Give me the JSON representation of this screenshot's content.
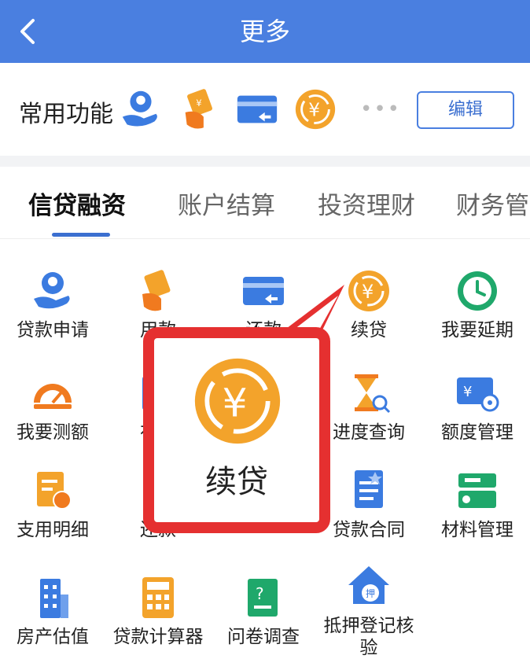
{
  "header": {
    "title": "更多"
  },
  "common": {
    "label": "常用功能",
    "icons": [
      "loan-apply-icon",
      "repay-icon",
      "card-icon",
      "yuan-coin-icon"
    ],
    "more": "•••",
    "edit_label": "编辑"
  },
  "tabs": [
    {
      "label": "信贷融资",
      "active": true
    },
    {
      "label": "账户结算"
    },
    {
      "label": "投资理财"
    },
    {
      "label": "财务管理"
    }
  ],
  "grid": [
    {
      "label": "贷款申请",
      "icon": "loan-apply-icon"
    },
    {
      "label": "用款",
      "icon": "repay-icon"
    },
    {
      "label": "还款",
      "icon": "card-icon"
    },
    {
      "label": "续贷",
      "icon": "yuan-coin-icon"
    },
    {
      "label": "我要延期",
      "icon": "clock-icon"
    },
    {
      "label": "我要测额",
      "icon": "gauge-icon"
    },
    {
      "label": "在线",
      "icon": "loan-icon"
    },
    {
      "label": "",
      "icon": ""
    },
    {
      "label": "进度查询",
      "icon": "hourglass-search-icon"
    },
    {
      "label": "额度管理",
      "icon": "quota-card-icon"
    },
    {
      "label": "支用明细",
      "icon": "detail-doc-icon"
    },
    {
      "label": "还款",
      "icon": "repay-doc-icon"
    },
    {
      "label": "",
      "icon": ""
    },
    {
      "label": "贷款合同",
      "icon": "contract-icon"
    },
    {
      "label": "材料管理",
      "icon": "folder-icon"
    },
    {
      "label": "房产估值",
      "icon": "building-icon"
    },
    {
      "label": "贷款计算器",
      "icon": "calculator-icon"
    },
    {
      "label": "问卷调查",
      "icon": "survey-icon"
    },
    {
      "label": "抵押登记核验",
      "icon": "mortgage-house-icon"
    },
    {
      "label": "",
      "icon": ""
    }
  ],
  "callout": {
    "label": "续贷",
    "icon": "yuan-coin-icon",
    "border_color": "#e53030"
  },
  "colors": {
    "header": "#4a7fe0",
    "accent": "#3b6fd0",
    "orange": "#f3a32b",
    "green": "#1fa86b"
  }
}
